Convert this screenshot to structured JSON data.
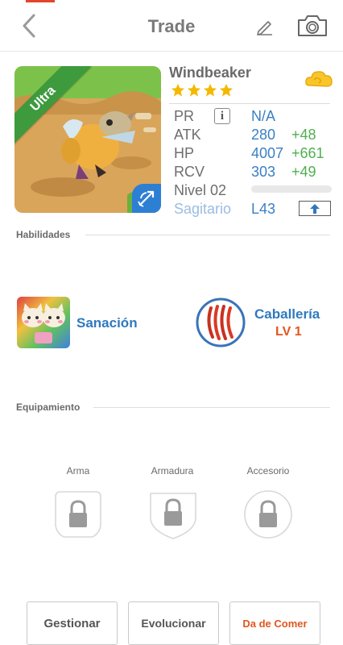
{
  "header": {
    "title": "Trade",
    "back_icon": "chevron-left-icon",
    "edit_icon": "pencil-icon",
    "camera_icon": "camera-icon"
  },
  "portrait": {
    "rarity_label": "Ultra",
    "class_icon": "bow-arrow-icon"
  },
  "character": {
    "name": "Windbeaker",
    "stars": 4,
    "element_icon": "cloud-icon",
    "stats": [
      {
        "label": "PR",
        "value": "N/A",
        "bonus": ""
      },
      {
        "label": "ATK",
        "value": "280",
        "bonus": "+48"
      },
      {
        "label": "HP",
        "value": "4007",
        "bonus": "+661"
      },
      {
        "label": "RCV",
        "value": "303",
        "bonus": "+49"
      }
    ],
    "level_label": "Nivel 02",
    "level_progress": 0.0,
    "zodiac": "Sagitario",
    "zodiac_level": "L43",
    "info_label": "i"
  },
  "skills": {
    "section_title": "Habilidades",
    "items": [
      {
        "name": "Sanación",
        "icon": "healing-cats-icon",
        "level": ""
      },
      {
        "name": "Caballería",
        "icon": "claw-marks-icon",
        "level": "LV 1"
      }
    ]
  },
  "equipment": {
    "section_title": "Equipamiento",
    "slots": [
      {
        "label": "Arma",
        "icon": "lock-icon"
      },
      {
        "label": "Armadura",
        "icon": "lock-icon"
      },
      {
        "label": "Accesorio",
        "icon": "lock-icon"
      }
    ]
  },
  "actions": {
    "manage": "Gestionar",
    "evolve": "Evolucionar",
    "feed": "Da de Comer"
  },
  "colors": {
    "accent_blue": "#2f79be",
    "bonus_green": "#4fb04f",
    "level_orange": "#e0561f",
    "ribbon_green": "#3d9a3d"
  }
}
